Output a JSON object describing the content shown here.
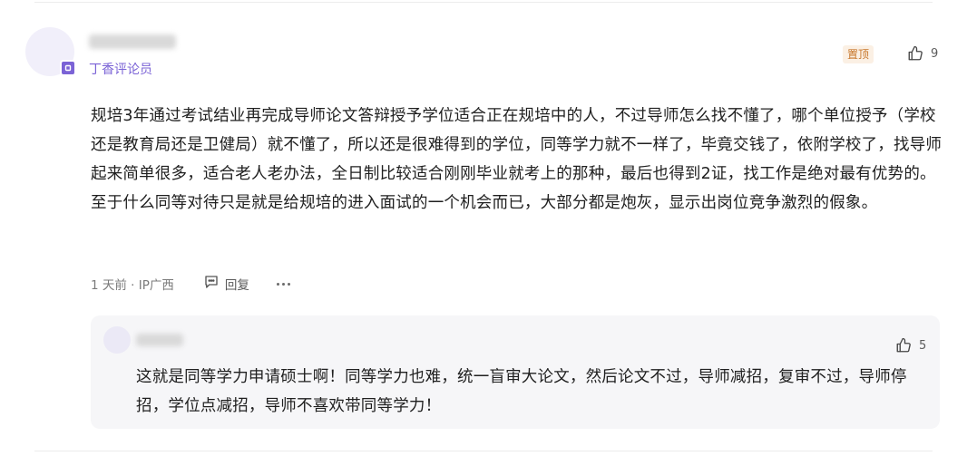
{
  "comment": {
    "role": "丁香评论员",
    "pin_label": "置顶",
    "like_count": "9",
    "text": "规培3年通过考试结业再完成导师论文答辩授予学位适合正在规培中的人，不过导师怎么找不懂了，哪个单位授予（学校还是教育局还是卫健局）就不懂了，所以还是很难得到的学位，同等学力就不一样了，毕竟交钱了，依附学校了，找导师起来简单很多，适合老人老办法，全日制比较适合刚刚毕业就考上的那种，最后也得到2证，找工作是绝对最有优势的。至于什么同等对待只是就是给规培的进入面试的一个机会而已，大部分都是炮灰，显示出岗位竞争激烈的假象。",
    "time": "1 天前 · IP广西",
    "reply_label": "回复",
    "icons": [
      "badge-icon",
      "thumbs-up-icon",
      "comment-icon",
      "more-icon"
    ]
  },
  "reply": {
    "like_count": "5",
    "text": "这就是同等学力申请硕士啊！同等学力也难，统一盲审大论文，然后论文不过，导师减招，复审不过，导师停招，学位点减招，导师不喜欢带同等学力！"
  },
  "colors": {
    "accent": "#7b63d6",
    "pin_text": "#c7762a",
    "pin_bg": "#fbf0e4",
    "reply_bg": "#f6f6f8"
  }
}
